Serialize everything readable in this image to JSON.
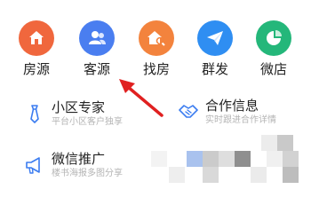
{
  "quick_actions": [
    {
      "label": "房源",
      "icon": "house-icon",
      "color": "#f0673d"
    },
    {
      "label": "客源",
      "icon": "customers-icon",
      "color": "#4a7ef0"
    },
    {
      "label": "找房",
      "icon": "find-house-icon",
      "color": "#f3833d"
    },
    {
      "label": "群发",
      "icon": "send-icon",
      "color": "#2f8ef2"
    },
    {
      "label": "微店",
      "icon": "shop-icon",
      "color": "#24b77a"
    }
  ],
  "features": {
    "expert": {
      "title": "小区专家",
      "subtitle": "平台小区客户独享",
      "icon": "tie-icon"
    },
    "coop": {
      "title": "合作信息",
      "subtitle": "实时跟进合作详情",
      "icon": "handshake-icon"
    },
    "promo": {
      "title": "微信推广",
      "subtitle": "楼书海报多图分享",
      "icon": "megaphone-icon"
    }
  },
  "annotation": {
    "color": "#e02020"
  }
}
